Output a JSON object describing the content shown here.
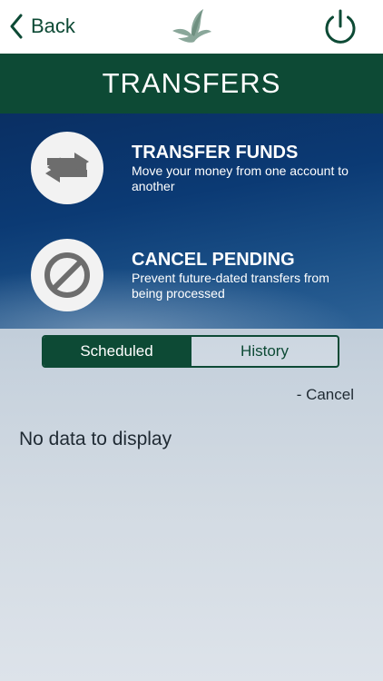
{
  "header": {
    "back_label": "Back",
    "back_icon": "chevron-left-icon",
    "logo_icon": "bird-logo-icon",
    "power_icon": "power-icon"
  },
  "title": "TRANSFERS",
  "actions": [
    {
      "title": "TRANSFER FUNDS",
      "description": "Move your money from one account to another",
      "icon": "transfer-arrows-icon"
    },
    {
      "title": "CANCEL PENDING",
      "description": "Prevent future-dated transfers from being processed",
      "icon": "cancel-icon"
    }
  ],
  "tabs": {
    "scheduled": "Scheduled",
    "history": "History",
    "selected": "Scheduled"
  },
  "cancel_link": "- Cancel",
  "empty_message": "No data to display",
  "colors": {
    "brand_green": "#0d4a35",
    "hero_blue": "#0b3a74",
    "icon_gray": "#6d6d6d"
  }
}
